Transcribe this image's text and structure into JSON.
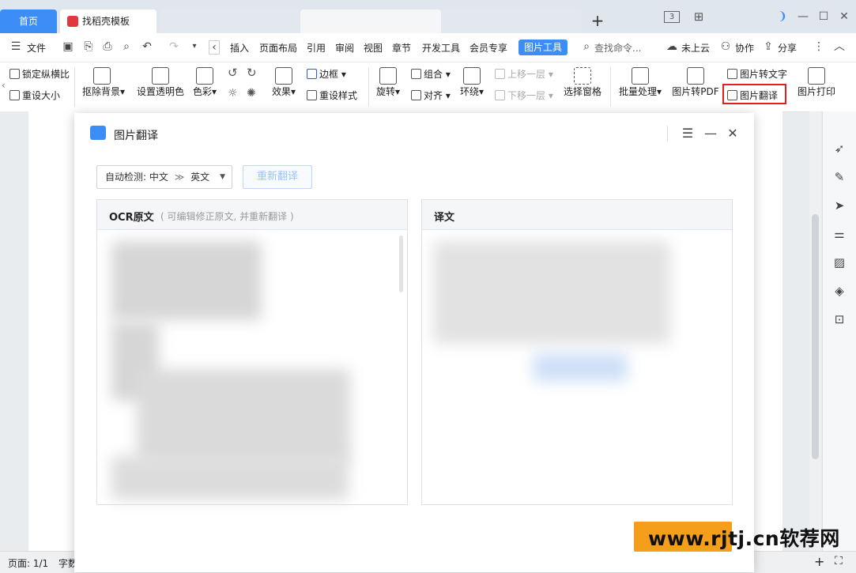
{
  "tabs": {
    "home": "首页",
    "doc": "找稻壳模板",
    "add": "+"
  },
  "window": {
    "page_count_icon": "3",
    "minimize": "—",
    "maximize": "☐",
    "close": "✕"
  },
  "menu": {
    "file": "文件",
    "items": [
      "插入",
      "页面布局",
      "引用",
      "审阅",
      "视图",
      "章节",
      "开发工具",
      "会员专享"
    ],
    "picture_tools": "图片工具",
    "search": "查找命令...",
    "cloud": "未上云",
    "collab": "协作",
    "share": "分享"
  },
  "ribbon": {
    "lock_ratio": "锁定纵横比",
    "reset_size": "重设大小",
    "remove_bg": "抠除背景",
    "set_transparent": "设置透明色",
    "color": "色彩",
    "effect": "效果",
    "border": "边框",
    "reset_style": "重设样式",
    "rotate": "旋转",
    "group": "组合",
    "align": "对齐",
    "wrap": "环绕",
    "bring_forward": "上移一层",
    "send_backward": "下移一层",
    "selection_pane": "选择窗格",
    "batch": "批量处理",
    "to_pdf": "图片转PDF",
    "to_text": "图片转文字",
    "translate": "图片翻译",
    "print": "图片打印"
  },
  "dialog": {
    "title": "图片翻译",
    "lang_label": "自动检测: 中文",
    "lang_sep": "≫",
    "lang_target": "英文",
    "retranslate": "重新翻译",
    "ocr_title": "OCR原文",
    "ocr_hint": "( 可编辑修正原文, 并重新翻译 )",
    "translation_title": "译文"
  },
  "statusbar": {
    "page": "页面: 1/1",
    "words": "字数"
  },
  "watermark": "www.rjtj.cn软荐网",
  "colors": {
    "accent": "#3c8df6",
    "highlight": "#e02020",
    "orange": "#f59e1b"
  }
}
